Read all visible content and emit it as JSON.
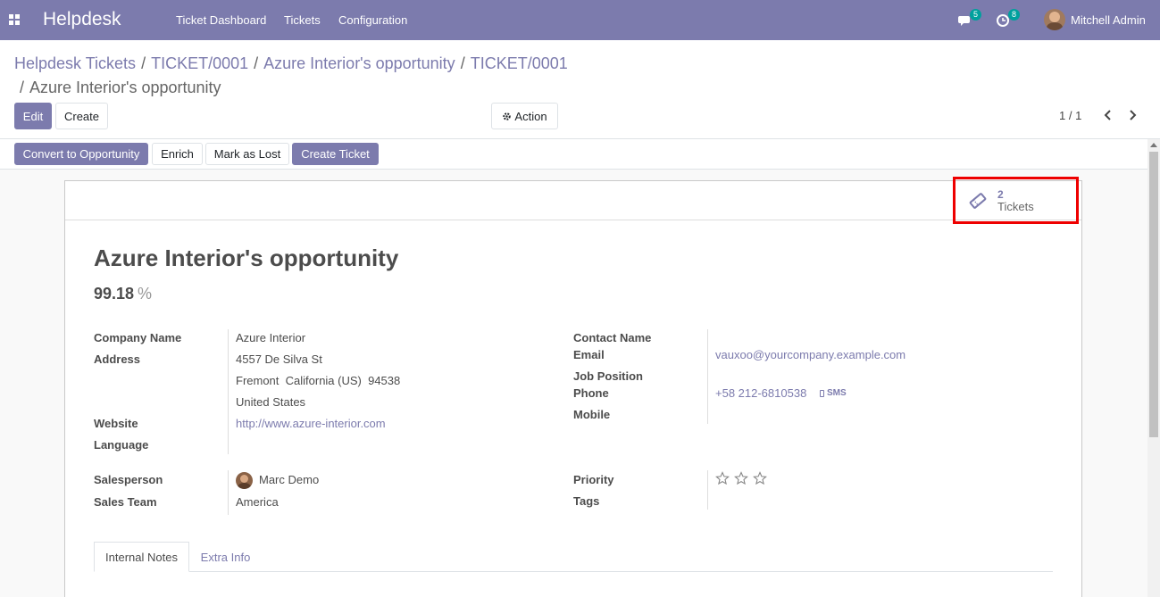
{
  "navbar": {
    "brand": "Helpdesk",
    "menu": [
      "Ticket Dashboard",
      "Tickets",
      "Configuration"
    ],
    "messages_count": "5",
    "activities_count": "8",
    "user_name": "Mitchell Admin"
  },
  "breadcrumb": {
    "items": [
      "Helpdesk Tickets",
      "TICKET/0001",
      "Azure Interior's opportunity",
      "TICKET/0001"
    ],
    "current": "Azure Interior's opportunity",
    "separator": "/"
  },
  "controls": {
    "edit_label": "Edit",
    "create_label": "Create",
    "action_label": "Action",
    "pager": "1 / 1"
  },
  "statusbar": {
    "convert_label": "Convert to Opportunity",
    "enrich_label": "Enrich",
    "lost_label": "Mark as Lost",
    "create_ticket_label": "Create Ticket"
  },
  "smart_button": {
    "value": "2",
    "label": "Tickets"
  },
  "record": {
    "title": "Azure Interior's opportunity",
    "probability": "99.18",
    "probability_unit": "%"
  },
  "fields_left": {
    "company_name_label": "Company Name",
    "company_name": "Azure Interior",
    "address_label": "Address",
    "street": "4557 De Silva St",
    "city_line": "Fremont  California (US)  94538",
    "country": "United States",
    "website_label": "Website",
    "website": "http://www.azure-interior.com",
    "language_label": "Language",
    "salesperson_label": "Salesperson",
    "salesperson": "Marc Demo",
    "sales_team_label": "Sales Team",
    "sales_team": "America"
  },
  "fields_right": {
    "contact_name_label": "Contact Name",
    "email_label": "Email",
    "email": "vauxoo@yourcompany.example.com",
    "job_position_label": "Job Position",
    "phone_label": "Phone",
    "phone": "+58 212-6810538",
    "sms_label": "SMS",
    "mobile_label": "Mobile",
    "priority_label": "Priority",
    "priority_stars_filled": 0,
    "priority_stars_total": 3,
    "tags_label": "Tags"
  },
  "tabs": {
    "internal_notes": "Internal Notes",
    "extra_info": "Extra Info"
  },
  "colors": {
    "brand": "#7c7bad",
    "highlight": "#ee0000"
  }
}
